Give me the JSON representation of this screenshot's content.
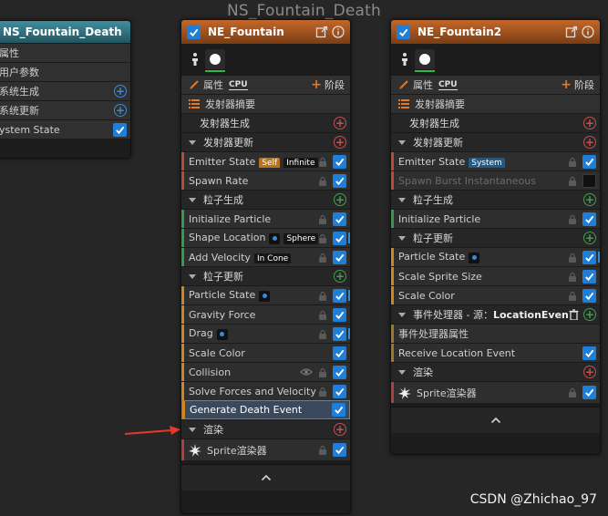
{
  "graph_title": "NS_Fountain_Death",
  "node_left": {
    "title": "NS_Fountain_Death",
    "rows": [
      "属性",
      "用户参数",
      "系统生成",
      "系统更新",
      "ystem State"
    ]
  },
  "node_mid": {
    "title": "NE_Fountain",
    "props_label": "属性",
    "cpu": "CPU",
    "stage_label": "阶段",
    "summary": "发射器摘要",
    "emitter_spawn": "发射器生成",
    "emitter_update": "发射器更新",
    "emitter_state": "Emitter State",
    "tag_self": "Self",
    "tag_infinite": "Infinite",
    "spawn_rate": "Spawn Rate",
    "particle_spawn": "粒子生成",
    "init_particle": "Initialize Particle",
    "shape_location": "Shape Location",
    "tag_sphere": "Sphere",
    "add_velocity": "Add Velocity",
    "tag_incone": "In Cone",
    "particle_update": "粒子更新",
    "particle_state": "Particle State",
    "gravity": "Gravity Force",
    "drag": "Drag",
    "scale_color": "Scale Color",
    "collision": "Collision",
    "solve": "Solve Forces and Velocity",
    "gen_death": "Generate Death Event",
    "render": "渲染",
    "sprite": "Sprite渲染器"
  },
  "node_right": {
    "title": "NE_Fountain2",
    "props_label": "属性",
    "cpu": "CPU",
    "stage_label": "阶段",
    "summary": "发射器摘要",
    "emitter_spawn": "发射器生成",
    "emitter_update": "发射器更新",
    "emitter_state": "Emitter State",
    "tag_system": "System",
    "spawn_burst": "Spawn Burst Instantaneous",
    "particle_spawn": "粒子生成",
    "init_particle": "Initialize Particle",
    "particle_update": "粒子更新",
    "particle_state": "Particle State",
    "scale_sprite": "Scale Sprite Size",
    "scale_color": "Scale Color",
    "event_handler_prefix": "事件处理器 - 源：",
    "event_handler_src": "LocationEvent",
    "event_props": "事件处理器属性",
    "receive_event": "Receive Location Event",
    "render": "渲染",
    "sprite": "Sprite渲染器"
  },
  "watermark": "CSDN @Zhichao_97",
  "colors": {
    "accent_blue": "#1f7ed8",
    "header_orange": "#c4672a",
    "header_teal": "#3f8ea0",
    "arrow_red": "#e53a2a"
  }
}
